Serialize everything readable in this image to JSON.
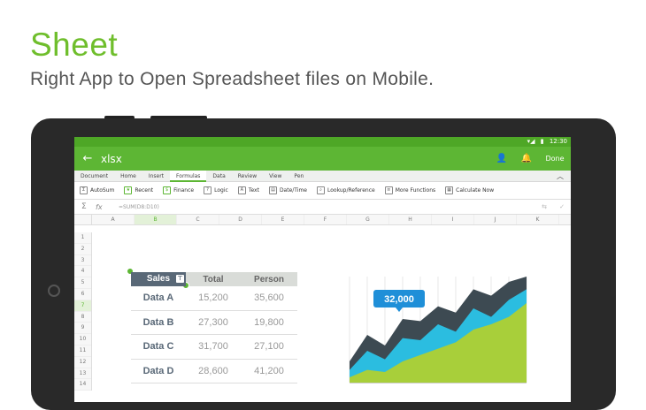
{
  "hero": {
    "title": "Sheet",
    "subtitle": "Right App to Open Spreadsheet files on Mobile."
  },
  "status_bar": {
    "signal": "▾◢",
    "battery": "▮",
    "time": "12:30"
  },
  "app_bar": {
    "back_icon": "←",
    "title": "xlsx",
    "share_icon": "👤",
    "bell_icon": "🔔",
    "done_label": "Done"
  },
  "tabs": [
    "Document",
    "Home",
    "Insert",
    "Formulas",
    "Data",
    "Review",
    "View",
    "Pen"
  ],
  "active_tab": "Formulas",
  "ribbon": [
    {
      "label": "AutoSum",
      "icon": "Σ"
    },
    {
      "label": "Recent",
      "icon": "★"
    },
    {
      "label": "Finance",
      "icon": "$"
    },
    {
      "label": "Logic",
      "icon": "?"
    },
    {
      "label": "Text",
      "icon": "A"
    },
    {
      "label": "Date/Time",
      "icon": "▤"
    },
    {
      "label": "Lookup/Reference",
      "icon": "⌕"
    },
    {
      "label": "More Functions",
      "icon": "≡"
    },
    {
      "label": "Calculate Now",
      "icon": "▦"
    }
  ],
  "formula_bar": {
    "sigma": "Σ",
    "fx": "fx",
    "formula": "=SUM(D8:D10)"
  },
  "columns": [
    "A",
    "B",
    "C",
    "D",
    "E",
    "F",
    "G",
    "H",
    "I",
    "J",
    "K"
  ],
  "selected_column": "B",
  "rows": [
    "1",
    "2",
    "3",
    "4",
    "5",
    "6",
    "7",
    "8",
    "9",
    "10",
    "11",
    "12",
    "13",
    "14"
  ],
  "selected_row": "7",
  "table": {
    "headers": [
      "Sales",
      "Total",
      "Person"
    ],
    "rows": [
      {
        "label": "Data A",
        "total": "15,200",
        "person": "35,600"
      },
      {
        "label": "Data B",
        "total": "27,300",
        "person": "19,800"
      },
      {
        "label": "Data C",
        "total": "31,700",
        "person": "27,100"
      },
      {
        "label": "Data D",
        "total": "28,600",
        "person": "41,200"
      }
    ]
  },
  "chart_data": {
    "type": "area",
    "callout": "32,000",
    "x": [
      0,
      1,
      2,
      3,
      4,
      5,
      6,
      7,
      8,
      9,
      10
    ],
    "ylim": [
      0,
      100
    ],
    "series": [
      {
        "values": [
          20,
          45,
          35,
          60,
          58,
          72,
          66,
          88,
          82,
          95,
          100
        ],
        "color": "#3d4a52"
      },
      {
        "values": [
          12,
          30,
          22,
          42,
          40,
          55,
          48,
          70,
          62,
          78,
          88
        ],
        "color": "#2bbde0"
      },
      {
        "values": [
          5,
          12,
          10,
          20,
          26,
          32,
          38,
          50,
          55,
          62,
          75
        ],
        "color": "#a8cf3a"
      }
    ],
    "grid": true
  },
  "colors": {
    "accent": "#5db634",
    "brand_green": "#6fbe2c",
    "header_dark": "#596877"
  }
}
